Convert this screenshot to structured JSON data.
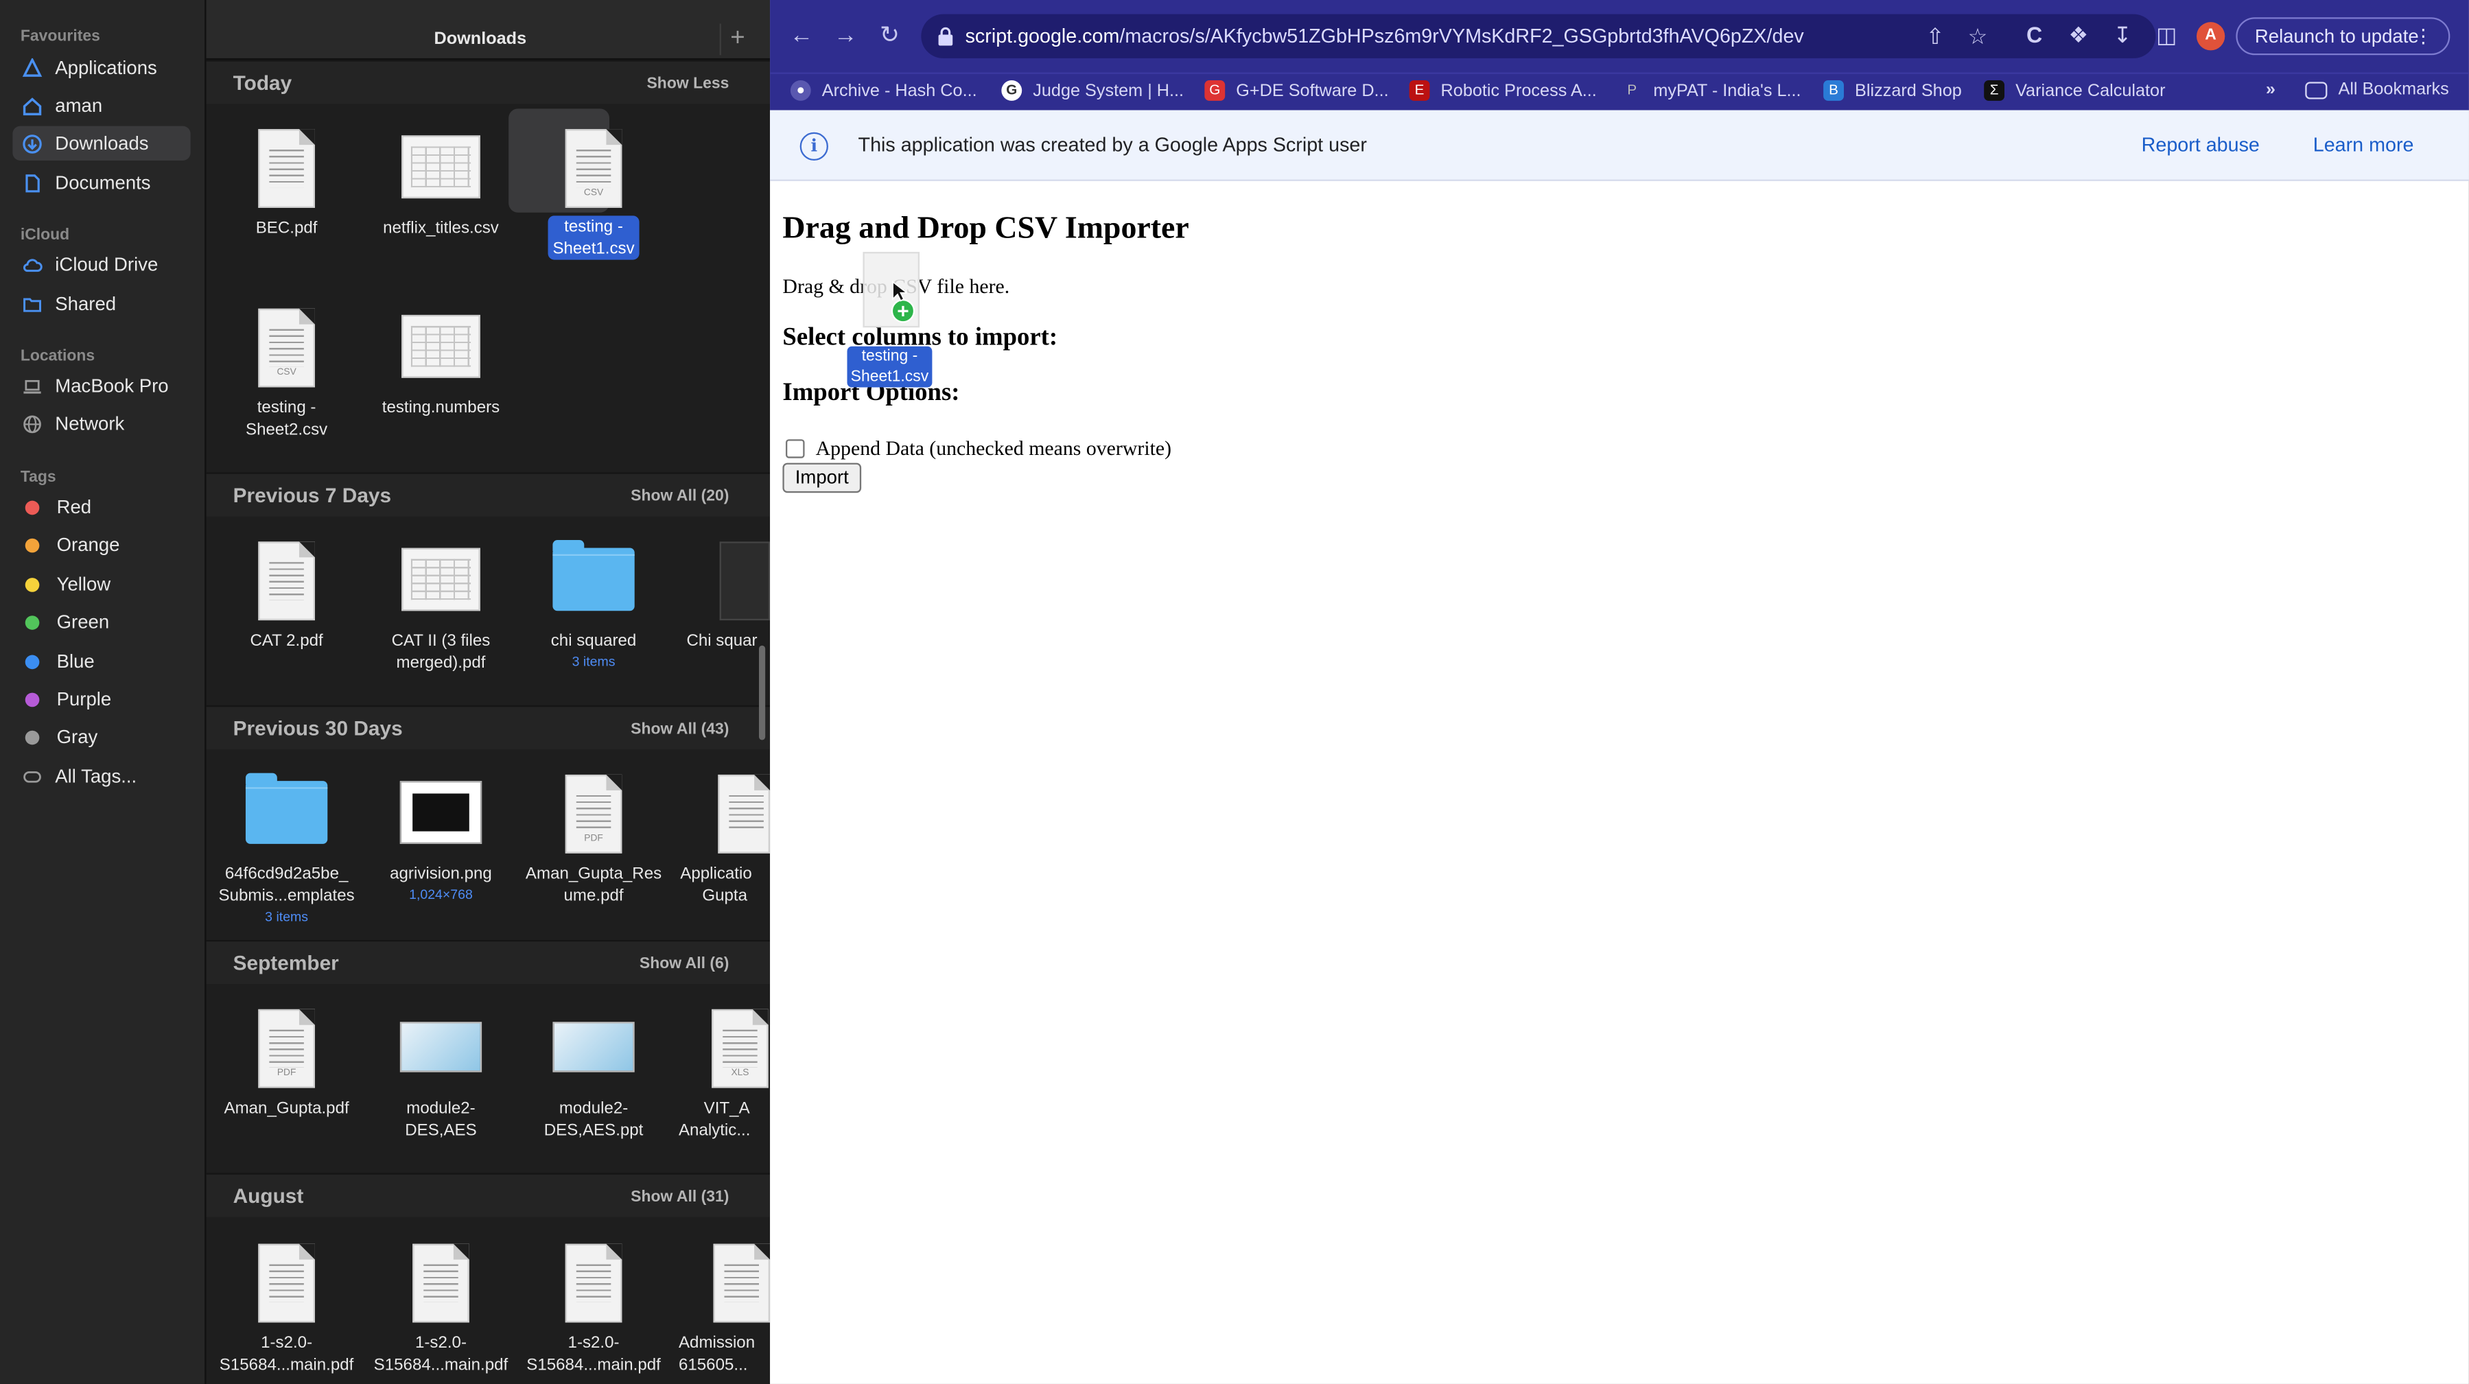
{
  "finder": {
    "window_title": "Downloads",
    "sidebar": {
      "favourites_heading": "Favourites",
      "favourites": [
        {
          "label": "Applications",
          "icon": "applications-icon"
        },
        {
          "label": "aman",
          "icon": "home-icon"
        },
        {
          "label": "Downloads",
          "icon": "downloads-icon",
          "selected": true
        },
        {
          "label": "Documents",
          "icon": "documents-icon"
        }
      ],
      "icloud_heading": "iCloud",
      "icloud": [
        {
          "label": "iCloud Drive",
          "icon": "cloud-icon"
        },
        {
          "label": "Shared",
          "icon": "shared-folder-icon"
        }
      ],
      "locations_heading": "Locations",
      "locations": [
        {
          "label": "MacBook Pro",
          "icon": "laptop-icon"
        },
        {
          "label": "Network",
          "icon": "globe-icon"
        }
      ],
      "tags_heading": "Tags",
      "tags": [
        {
          "label": "Red",
          "color": "#ec5b56"
        },
        {
          "label": "Orange",
          "color": "#f3a33a"
        },
        {
          "label": "Yellow",
          "color": "#f5d23b"
        },
        {
          "label": "Green",
          "color": "#52c55b"
        },
        {
          "label": "Blue",
          "color": "#3b8ef2"
        },
        {
          "label": "Purple",
          "color": "#b65bd7"
        },
        {
          "label": "Gray",
          "color": "#9a9a9a"
        }
      ],
      "all_tags": "All Tags..."
    },
    "sections": {
      "today": {
        "title": "Today",
        "link": "Show Less",
        "items": [
          {
            "name": "BEC.pdf"
          },
          {
            "name": "netflix_titles.csv"
          },
          {
            "name": "testing -",
            "name2": "Sheet1.csv",
            "selected": true
          },
          {
            "name": "testing -",
            "name2": "Sheet2.csv"
          },
          {
            "name": "testing.numbers"
          }
        ]
      },
      "previous7": {
        "title": "Previous 7 Days",
        "link": "Show All (20)",
        "items": [
          {
            "name": "CAT 2.pdf"
          },
          {
            "name": "CAT II (3 files",
            "name2": "merged).pdf"
          },
          {
            "name": "chi squared",
            "sub": "3 items"
          },
          {
            "name": "Chi squar"
          }
        ]
      },
      "previous30": {
        "title": "Previous 30 Days",
        "link": "Show All (43)",
        "items": [
          {
            "name": "64f6cd9d2a5be_",
            "name2": "Submis...emplates",
            "sub": "3 items"
          },
          {
            "name": "agrivision.png",
            "sub": "1,024×768"
          },
          {
            "name": "Aman_Gupta_Res",
            "name2": "ume.pdf"
          },
          {
            "name": "Applicatio",
            "name2": "Gupta"
          }
        ]
      },
      "september": {
        "title": "September",
        "link": "Show All (6)",
        "items": [
          {
            "name": "Aman_Gupta.pdf"
          },
          {
            "name": "module2-",
            "name2": "DES,AES"
          },
          {
            "name": "module2-",
            "name2": "DES,AES.ppt"
          },
          {
            "name": "VIT_A",
            "name2": "Analytic..."
          }
        ]
      },
      "august": {
        "title": "August",
        "link": "Show All (31)",
        "items": [
          {
            "name": "1-s2.0-",
            "name2": "S15684...main.pdf"
          },
          {
            "name": "1-s2.0-",
            "name2": "S15684...main.pdf"
          },
          {
            "name": "1-s2.0-",
            "name2": "S15684...main.pdf"
          },
          {
            "name": "Admission",
            "name2": "615605..."
          }
        ]
      }
    },
    "file_tags": {
      "csv": "CSV",
      "pdf": "PDF",
      "xls": "XLS"
    }
  },
  "browser": {
    "url_host": "script.google.com",
    "url_path": "/macros/s/AKfycbw51ZGbHPsz6m9rVYMsKdRF2_GSGpbrtd3fhAVQ6pZX/dev",
    "avatar_letter": "A",
    "relaunch_label": "Relaunch to update",
    "bookmarks": [
      {
        "label": "Archive - Hash Co...",
        "icon": "archive-icon"
      },
      {
        "label": "Judge System | H...",
        "icon": "google-icon"
      },
      {
        "label": "G+DE Software D...",
        "icon": "gde-icon"
      },
      {
        "label": "Robotic Process A...",
        "icon": "rpa-icon"
      },
      {
        "label": "myPAT - India's L...",
        "icon": "mypat-icon"
      },
      {
        "label": "Blizzard Shop",
        "icon": "blizzard-icon"
      },
      {
        "label": "Variance Calculator",
        "icon": "sigma-icon"
      }
    ],
    "more_bookmarks": "»",
    "all_bookmarks": "All Bookmarks",
    "banner": {
      "text": "This application was created by a Google Apps Script user",
      "report": "Report abuse",
      "learn": "Learn more"
    },
    "page": {
      "title": "Drag and Drop CSV Importer",
      "drop_text": "Drag & drop CSV file here.",
      "columns_heading": "Select columns to import:",
      "options_heading": "Import Options:",
      "append_label": "Append Data (unchecked means overwrite)",
      "append_checked": false,
      "import_button": "Import"
    },
    "drag_ghost": {
      "line1": "testing -",
      "line2": "Sheet1.csv"
    }
  },
  "colors": {
    "browser_toolbar": "#2f2d8f",
    "selection": "#2f5fd0",
    "folder": "#5ab6f0"
  }
}
